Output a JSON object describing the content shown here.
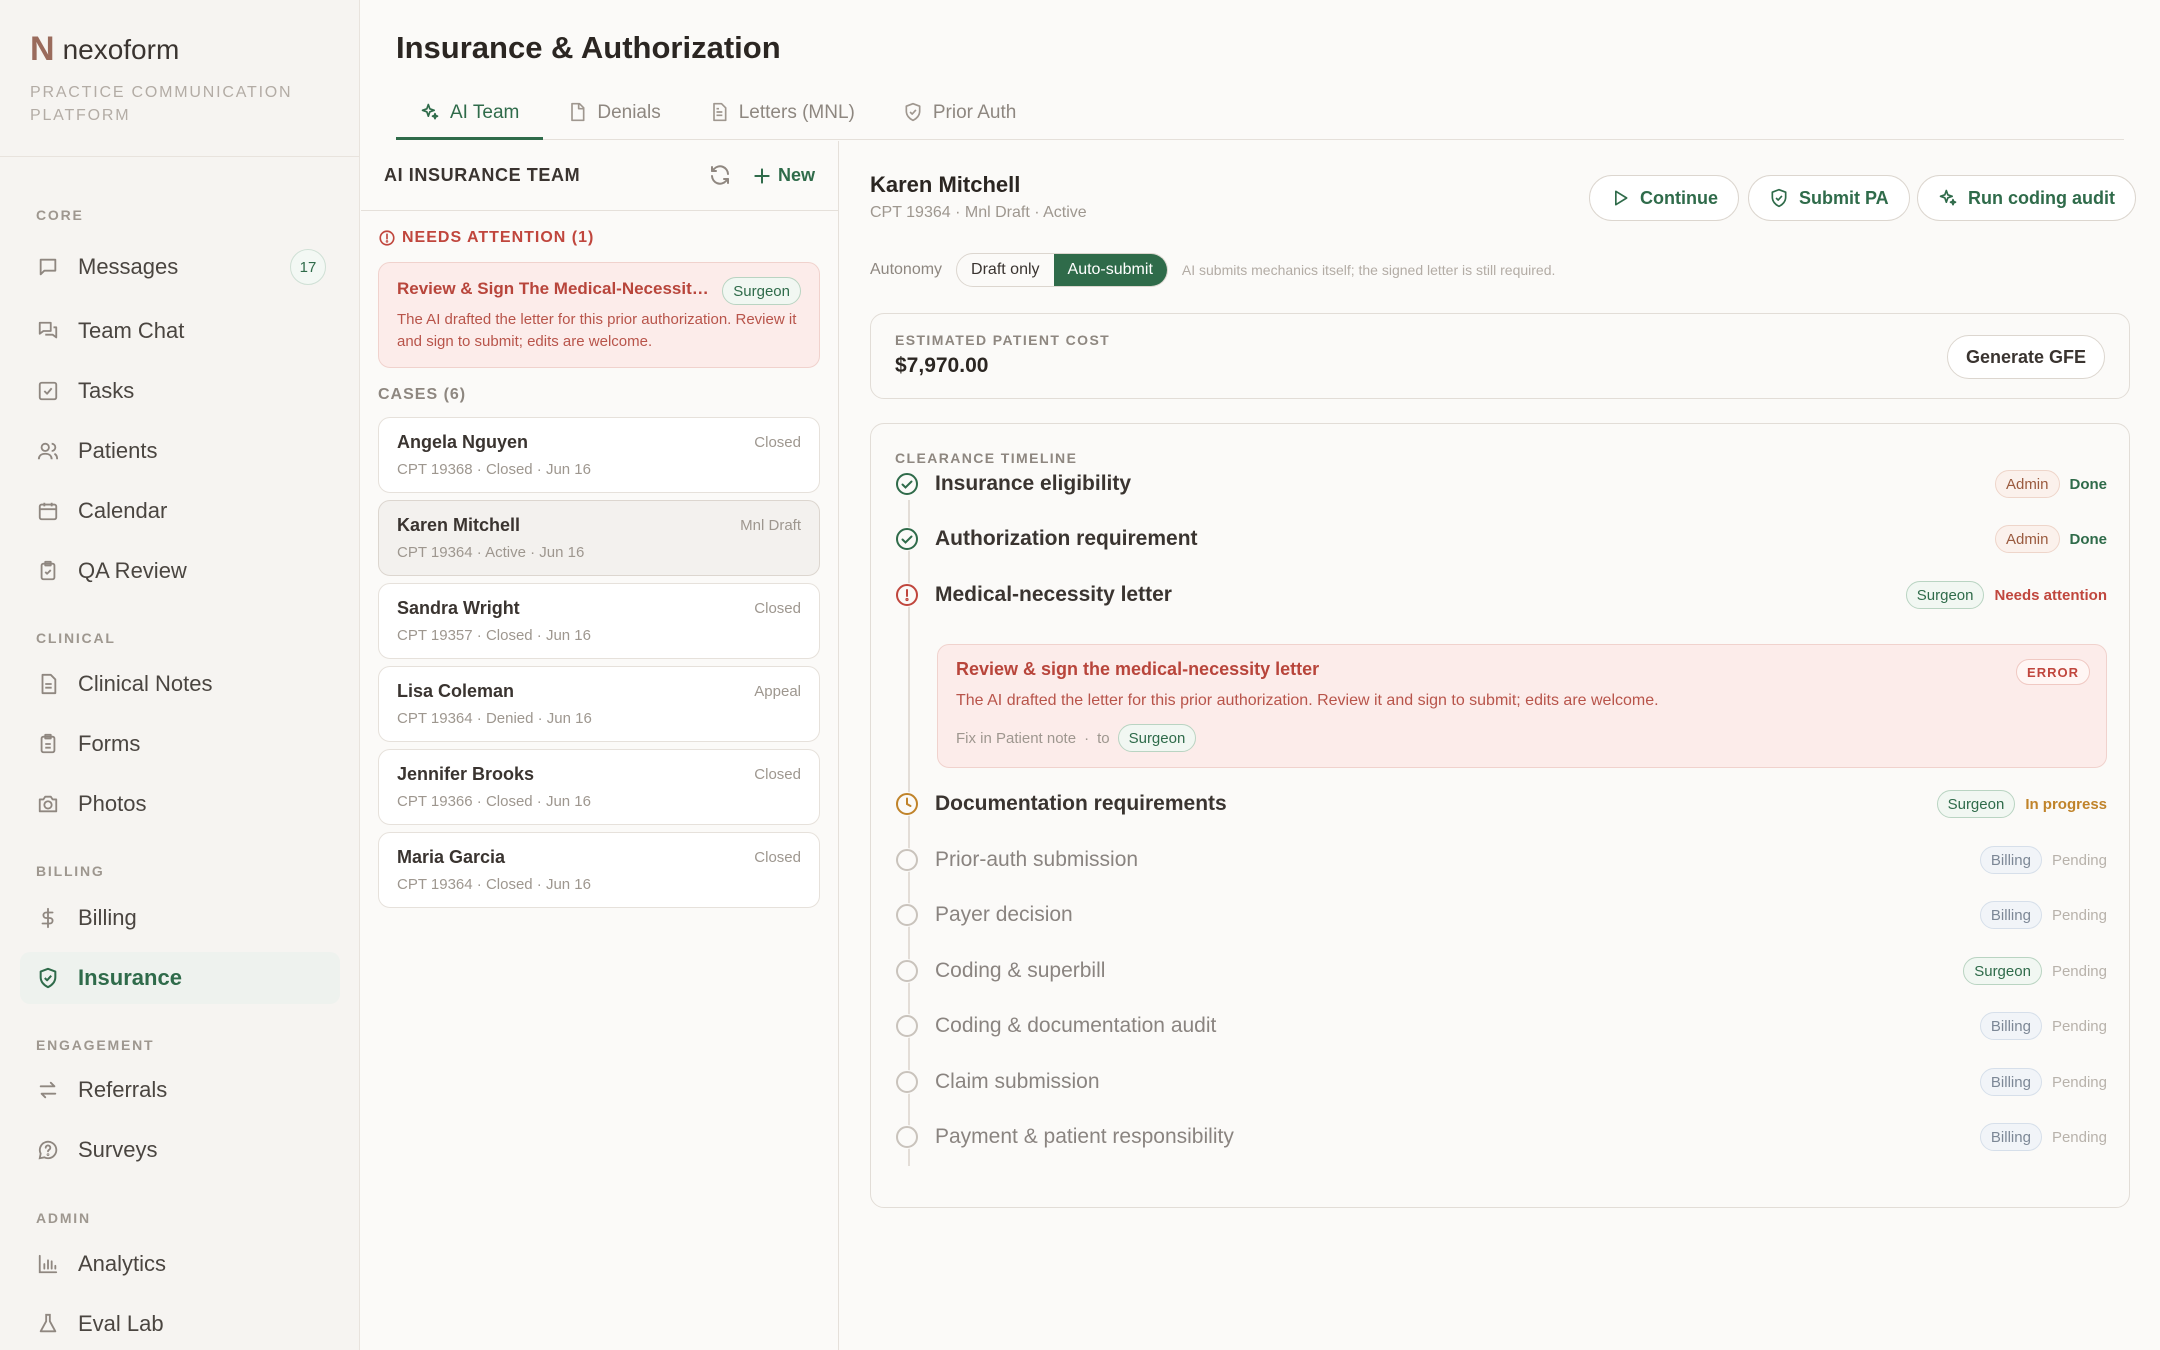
{
  "brand": {
    "logo": "N",
    "name": "nexoform",
    "subtitle": "PRACTICE COMMUNICATION PLATFORM"
  },
  "sidebar": {
    "sections": [
      {
        "label": "CORE",
        "items": [
          {
            "label": "Messages",
            "icon": "message-square-icon",
            "badge": "17"
          },
          {
            "label": "Team Chat",
            "icon": "chat-bubbles-icon"
          },
          {
            "label": "Tasks",
            "icon": "checkbox-icon"
          },
          {
            "label": "Patients",
            "icon": "users-icon"
          },
          {
            "label": "Calendar",
            "icon": "calendar-icon"
          },
          {
            "label": "QA Review",
            "icon": "clipboard-check-icon"
          }
        ]
      },
      {
        "label": "CLINICAL",
        "items": [
          {
            "label": "Clinical Notes",
            "icon": "document-lines-icon"
          },
          {
            "label": "Forms",
            "icon": "clipboard-icon"
          },
          {
            "label": "Photos",
            "icon": "camera-icon"
          }
        ]
      },
      {
        "label": "BILLING",
        "items": [
          {
            "label": "Billing",
            "icon": "dollar-icon"
          },
          {
            "label": "Insurance",
            "icon": "shield-check-icon",
            "active": true
          }
        ]
      },
      {
        "label": "ENGAGEMENT",
        "items": [
          {
            "label": "Referrals",
            "icon": "arrows-swap-icon"
          },
          {
            "label": "Surveys",
            "icon": "help-bubble-icon"
          }
        ]
      },
      {
        "label": "ADMIN",
        "items": [
          {
            "label": "Analytics",
            "icon": "bar-chart-icon"
          },
          {
            "label": "Eval Lab",
            "icon": "flask-icon"
          }
        ]
      }
    ]
  },
  "header": {
    "title": "Insurance & Authorization",
    "tabs": [
      {
        "label": "AI Team",
        "icon": "sparkles-icon",
        "active": true
      },
      {
        "label": "Denials",
        "icon": "file-icon"
      },
      {
        "label": "Letters (MNL)",
        "icon": "file-text-icon"
      },
      {
        "label": "Prior Auth",
        "icon": "shield-check-icon"
      }
    ]
  },
  "cases_panel": {
    "title": "AI INSURANCE TEAM",
    "new_label": "New",
    "needs_attention_label": "NEEDS ATTENTION (1)",
    "attention": {
      "title": "Review & Sign The Medical-Necessity Letter",
      "chip": "Surgeon",
      "body": "The AI drafted the letter for this prior authorization. Review it and sign to submit; edits are welcome."
    },
    "cases_label": "CASES (6)",
    "cases": [
      {
        "name": "Angela Nguyen",
        "status": "Closed",
        "meta": "CPT 19368 · Closed · Jun 16"
      },
      {
        "name": "Karen Mitchell",
        "status": "Mnl Draft",
        "meta": "CPT 19364 · Active · Jun 16",
        "selected": true
      },
      {
        "name": "Sandra Wright",
        "status": "Closed",
        "meta": "CPT 19357 · Closed · Jun 16"
      },
      {
        "name": "Lisa Coleman",
        "status": "Appeal",
        "meta": "CPT 19364 · Denied · Jun 16"
      },
      {
        "name": "Jennifer Brooks",
        "status": "Closed",
        "meta": "CPT 19366 · Closed · Jun 16"
      },
      {
        "name": "Maria Garcia",
        "status": "Closed",
        "meta": "CPT 19364 · Closed · Jun 16"
      }
    ]
  },
  "detail": {
    "name": "Karen Mitchell",
    "subtitle": "CPT 19364 · Mnl Draft · Active",
    "actions": {
      "continue": "Continue",
      "submit_pa": "Submit PA",
      "run_audit": "Run coding audit"
    },
    "autonomy": {
      "label": "Autonomy",
      "options": [
        "Draft only",
        "Auto-submit"
      ],
      "selected": "Auto-submit",
      "note": "AI submits mechanics itself; the signed letter is still required."
    },
    "cost": {
      "label": "ESTIMATED PATIENT COST",
      "value": "$7,970.00",
      "button": "Generate GFE"
    },
    "timeline": {
      "label": "CLEARANCE TIMELINE",
      "steps": [
        {
          "title": "Insurance eligibility",
          "role": "Admin",
          "state": "Done"
        },
        {
          "title": "Authorization requirement",
          "role": "Admin",
          "state": "Done"
        },
        {
          "title": "Medical-necessity letter",
          "role": "Surgeon",
          "state": "Needs attention"
        },
        {
          "title": "Documentation requirements",
          "role": "Surgeon",
          "state": "In progress"
        },
        {
          "title": "Prior-auth submission",
          "role": "Billing",
          "state": "Pending"
        },
        {
          "title": "Payer decision",
          "role": "Billing",
          "state": "Pending"
        },
        {
          "title": "Coding & superbill",
          "role": "Surgeon",
          "state": "Pending"
        },
        {
          "title": "Coding & documentation audit",
          "role": "Billing",
          "state": "Pending"
        },
        {
          "title": "Claim submission",
          "role": "Billing",
          "state": "Pending"
        },
        {
          "title": "Payment & patient responsibility",
          "role": "Billing",
          "state": "Pending"
        }
      ],
      "error": {
        "title": "Review & sign the medical-necessity letter",
        "tag": "ERROR",
        "body": "The AI drafted the letter for this prior authorization. Review it and sign to submit; edits are welcome.",
        "fix_label": "Fix in Patient note",
        "sep": "·",
        "to_label": "to",
        "to_role": "Surgeon"
      }
    }
  },
  "colors": {
    "accent": "#2f6b4a",
    "error": "#c0463d",
    "warning": "#c0832a",
    "brand": "#9a6b5c"
  }
}
